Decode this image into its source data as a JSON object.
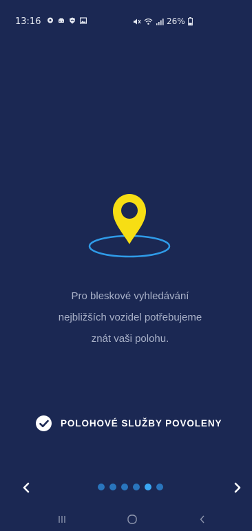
{
  "status_bar": {
    "time": "13:16",
    "battery_percent": "26%",
    "left_icons": [
      "notification-icon",
      "car-icon",
      "shield-icon",
      "image-icon"
    ],
    "right_icons": [
      "mute-icon",
      "wifi-icon",
      "signal-icon",
      "battery-icon"
    ]
  },
  "onboarding": {
    "message_lines": [
      "Pro bleskové vyhledávání",
      "nejbližších vozidel potřebujeme",
      "znát vaši polohu."
    ],
    "permission_label": "POLOHOVÉ SLUŽBY POVOLENY",
    "permission_granted": true,
    "page_count": 6,
    "active_page": 5
  },
  "colors": {
    "background": "#1b2853",
    "pin_yellow": "#f7de14",
    "ellipse_blue": "#2f9be8",
    "dot_blue": "#2f8fe0",
    "text_muted": "#a9b1c8"
  }
}
